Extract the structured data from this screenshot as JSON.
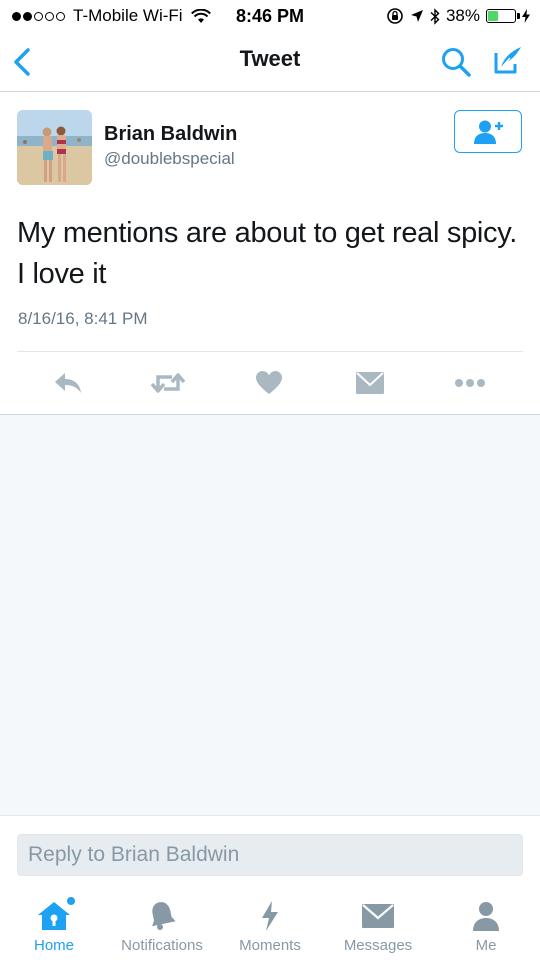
{
  "status_bar": {
    "carrier": "T-Mobile Wi-Fi",
    "time": "8:46 PM",
    "battery": "38%",
    "battery_level": 0.38
  },
  "nav": {
    "title": "Tweet",
    "icons": [
      "back-chevron-icon",
      "search-icon",
      "compose-icon"
    ]
  },
  "tweet": {
    "name": "Brian Baldwin",
    "handle": "@doublebspecial",
    "text": "My mentions are about to get real spicy. I love it",
    "timestamp": "8/16/16, 8:41 PM",
    "actions": [
      "reply-icon",
      "retweet-icon",
      "like-icon",
      "direct-message-icon",
      "more-icon"
    ]
  },
  "reply": {
    "placeholder": "Reply to Brian Baldwin"
  },
  "tabs": [
    {
      "label": "Home",
      "icon": "home-icon",
      "active": true
    },
    {
      "label": "Notifications",
      "icon": "bell-icon",
      "active": false
    },
    {
      "label": "Moments",
      "icon": "lightning-icon",
      "active": false
    },
    {
      "label": "Messages",
      "icon": "envelope-icon",
      "active": false
    },
    {
      "label": "Me",
      "icon": "person-icon",
      "active": false
    }
  ],
  "colors": {
    "accent": "#1da1f2",
    "inactive_icon": "#8899a6",
    "action_icon": "#aab8c2",
    "battery": "#4cd964"
  }
}
